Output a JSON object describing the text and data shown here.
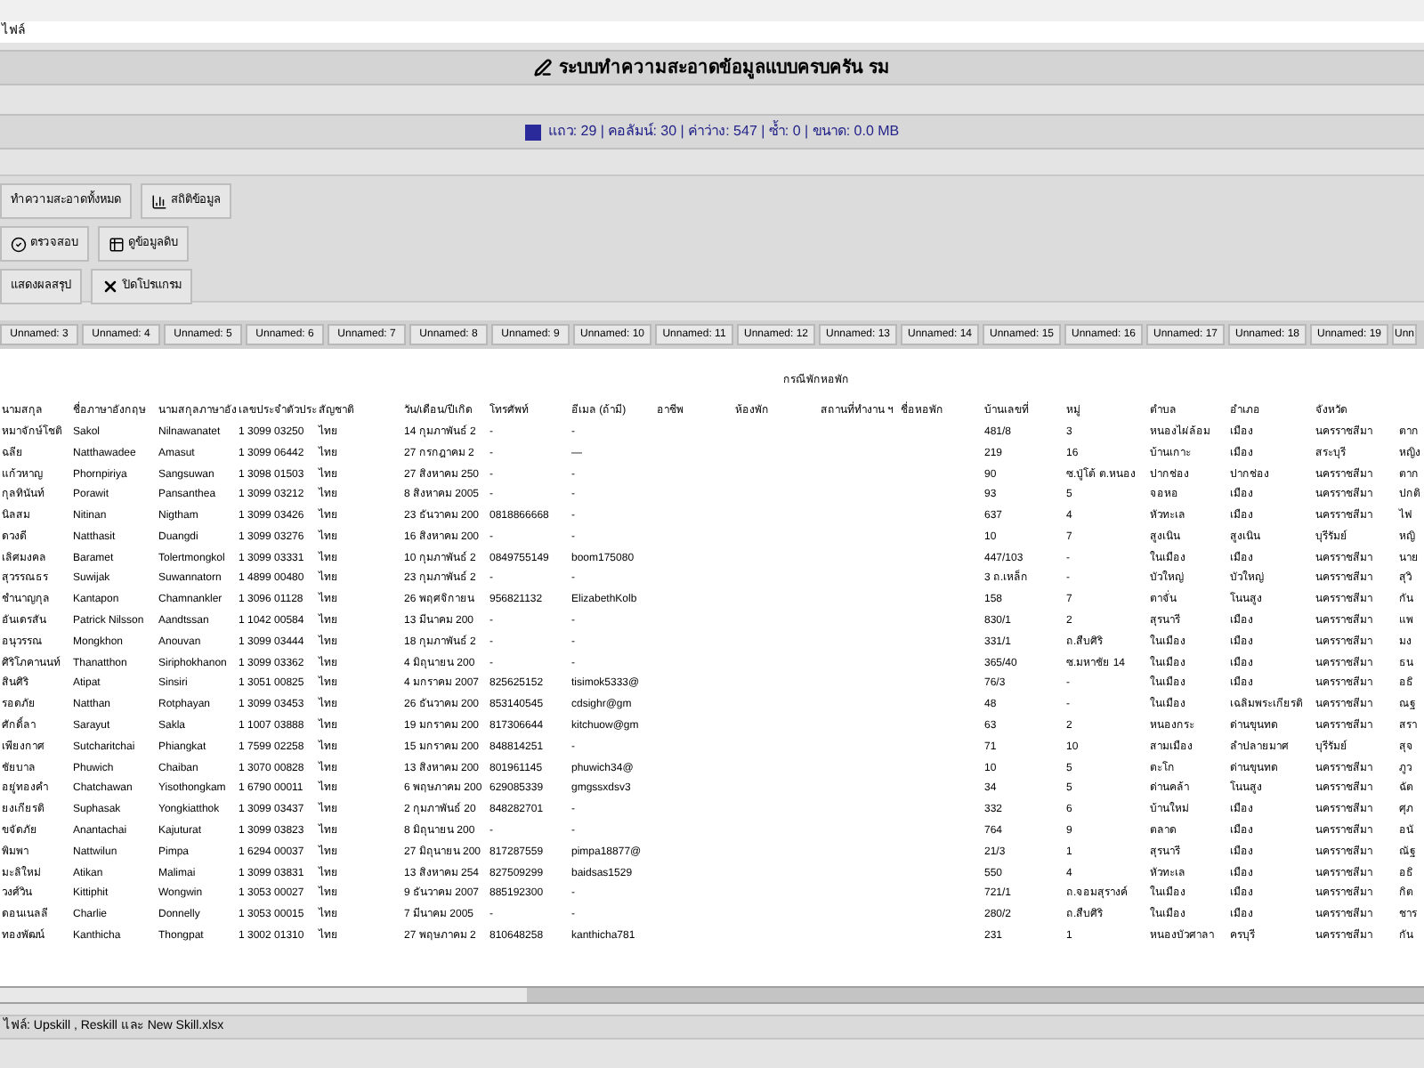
{
  "menu_bar": {
    "items": [
      "ไฟล์"
    ]
  },
  "title_bar": {
    "title": "ระบบทำความสะอาดข้อมูลแบบครบครัน รม"
  },
  "stats_bar": {
    "text": "แถว: 29 | คอลัมน์: 30 | ค่าว่าง: 547 | ซ้ำ: 0 | ขนาด: 0.0 MB"
  },
  "toolbar": {
    "rows": [
      [
        {
          "label": "ทำความสะอาดทั้งหมด",
          "kind": "plain"
        },
        {
          "label": "สถิติข้อมูล",
          "kind": "stats"
        }
      ],
      [
        {
          "label": "ตรวจสอบ",
          "kind": "check"
        },
        {
          "label": "ดูข้อมูลดิบ",
          "kind": "view"
        }
      ],
      [
        {
          "label": "แสดงผลสรุป",
          "kind": "plain"
        },
        {
          "label": "ปิดโปรแกรม",
          "kind": "exit"
        }
      ]
    ]
  },
  "column_chips": [
    "Unnamed: 3",
    "Unnamed: 4",
    "Unnamed: 5",
    "Unnamed: 6",
    "Unnamed: 7",
    "Unnamed: 8",
    "Unnamed: 9",
    "Unnamed: 10",
    "Unnamed: 11",
    "Unnamed: 12",
    "Unnamed: 13",
    "Unnamed: 14",
    "Unnamed: 15",
    "Unnamed: 16",
    "Unnamed: 17",
    "Unnamed: 18",
    "Unnamed: 19",
    "Unn"
  ],
  "table": {
    "group_header": "กรณีพักหอพัก",
    "columns": {
      "surname_th": "นามสกุล",
      "first_en": "ชื่อภาษาอังกฤษ",
      "last_en": "นามสกุลภาษาอัง",
      "id": "เลขประจำตัวประ",
      "nationality": "สัญชาติ",
      "dob": "วัน/เดือน/ปีเกิด",
      "phone": "โทรศัพท์",
      "email": "อีเมล (ถ้ามี)",
      "occupation": "อาชีพ",
      "dorm": "ห้องพัก",
      "workplace": "สถานที่ทำงาน ฯ",
      "dorm_name": "ชื่อหอพัก",
      "house_no": "บ้านเลขที่",
      "moo": "หมู่",
      "tambon": "ตำบล",
      "amphoe": "อำเภอ",
      "province": "จังหวัด"
    },
    "rows": [
      {
        "surname_th": "หมาจักษ์โชติ",
        "first_en": "Sakol",
        "last_en": "Nilnawanatet",
        "id": "1 3099 03250",
        "nationality": "ไทย",
        "dob": "14 กุมภาพันธ์ 2",
        "phone": "-",
        "email": "-",
        "house_no": "481/8",
        "moo": "3",
        "tambon": "หนองไผ่ล้อม",
        "amphoe": "เมือง",
        "province": "นครราชสีมา",
        "column_19": "ตาก"
      },
      {
        "surname_th": "ฉลีย",
        "first_en": "Natthawadee",
        "last_en": "Amasut",
        "id": "1 3099 06442",
        "nationality": "ไทย",
        "dob": "27 กรกฎาคม 2",
        "phone": "-",
        "email": "—",
        "house_no": "219",
        "moo": "16",
        "tambon": "บ้านเกาะ",
        "amphoe": "เมือง",
        "province": "สระบุรี",
        "column_19": "หญิง"
      },
      {
        "surname_th": "แก้วหาญ",
        "first_en": "Phornpiriya",
        "last_en": "Sangsuwan",
        "id": "1 3098 01503",
        "nationality": "ไทย",
        "dob": "27 สิงหาคม 250",
        "phone": "-",
        "email": "-",
        "house_no": "90",
        "moo": "ซ.ปู่โต้ ต.หนอง",
        "tambon": "ปากช่อง",
        "amphoe": "ปากช่อง",
        "province": "นครราชสีมา",
        "column_19": "ตาก"
      },
      {
        "surname_th": "กุลทินันท์",
        "first_en": "Porawit",
        "last_en": "Pansanthea",
        "id": "1 3099 03212",
        "nationality": "ไทย",
        "dob": "8 สิงหาคม 2005",
        "phone": "-",
        "email": "-",
        "house_no": "93",
        "moo": "5",
        "tambon": "จอหอ",
        "amphoe": "เมือง",
        "province": "นครราชสีมา",
        "column_19": "ปกติ"
      },
      {
        "surname_th": "นิลสม",
        "first_en": "Nitinan",
        "last_en": "Nigtham",
        "id": "1 3099 03426",
        "nationality": "ไทย",
        "dob": "23 ธันวาคม 200",
        "phone": "0818866668",
        "email": "-",
        "house_no": "637",
        "moo": "4",
        "tambon": "หัวทะเล",
        "amphoe": "เมือง",
        "province": "นครราชสีมา",
        "column_19": "ไฟ"
      },
      {
        "surname_th": "ดวงดี",
        "first_en": "Natthasit",
        "last_en": "Duangdi",
        "id": "1 3099 03276",
        "nationality": "ไทย",
        "dob": "16 สิงหาคม 200",
        "phone": "-",
        "email": "-",
        "house_no": "10",
        "moo": "7",
        "tambon": "สูงเนิน",
        "amphoe": "สูงเนิน",
        "province": "บุรีรัมย์",
        "column_19": "หญิ"
      },
      {
        "surname_th": "เลิศมงคล",
        "first_en": "Baramet",
        "last_en": "Tolertmongkol",
        "id": "1 3099 03331",
        "nationality": "ไทย",
        "dob": "10 กุมภาพันธ์ 2",
        "phone": "0849755149",
        "email": "boom175080",
        "house_no": "447/103",
        "moo": "-",
        "tambon": "ในเมือง",
        "amphoe": "เมือง",
        "province": "นครราชสีมา",
        "column_19": "นาย"
      },
      {
        "surname_th": "สุวรรณธร",
        "first_en": "Suwijak",
        "last_en": "Suwannatorn",
        "id": "1 4899 00480",
        "nationality": "ไทย",
        "dob": "23 กุมภาพันธ์ 2",
        "phone": "-",
        "email": "-",
        "house_no": "3 ถ.เหล็ก",
        "moo": "-",
        "tambon": "บัวใหญ่",
        "amphoe": "บัวใหญ่",
        "province": "นครราชสีมา",
        "column_19": "สุวิ"
      },
      {
        "surname_th": "ชำนาญกุล",
        "first_en": "Kantapon",
        "last_en": "Chamnankler",
        "id": "1 3096 01128",
        "nationality": "ไทย",
        "dob": "26 พฤศจิกายน",
        "phone": "956821132",
        "email": "ElizabethKolb",
        "house_no": "158",
        "moo": "7",
        "tambon": "ตาจั่น",
        "amphoe": "โนนสูง",
        "province": "นครราชสีมา",
        "column_19": "กัน"
      },
      {
        "surname_th": "อันเดรสัน",
        "first_en": "Patrick Nilsson",
        "last_en": "Aandtssan",
        "id": "1 1042 00584",
        "nationality": "ไทย",
        "dob": "13 มีนาคม 200",
        "phone": "-",
        "email": "-",
        "house_no": "830/1",
        "moo": "2",
        "tambon": "สุรนารี",
        "amphoe": "เมือง",
        "province": "นครราชสีมา",
        "column_19": "แพ"
      },
      {
        "surname_th": "อนุวรรณ",
        "first_en": "Mongkhon",
        "last_en": "Anouvan",
        "id": "1 3099 03444",
        "nationality": "ไทย",
        "dob": "18 กุมภาพันธ์ 2",
        "phone": "-",
        "email": "-",
        "house_no": "331/1",
        "moo": "ถ.สืบศิริ",
        "tambon": "ในเมือง",
        "amphoe": "เมือง",
        "province": "นครราชสีมา",
        "column_19": "มง"
      },
      {
        "surname_th": "ศิริโภคานนท์",
        "first_en": "Thanatthon",
        "last_en": "Siriphokhanon",
        "id": "1 3099 03362",
        "nationality": "ไทย",
        "dob": "4 มิถุนายน 200",
        "phone": "-",
        "email": "-",
        "house_no": "365/40",
        "moo": "ซ.มหาชัย 14",
        "tambon": "ในเมือง",
        "amphoe": "เมือง",
        "province": "นครราชสีมา",
        "column_19": "ธน"
      },
      {
        "surname_th": "สินศิริ",
        "first_en": "Atipat",
        "last_en": "Sinsiri",
        "id": "1 3051 00825",
        "nationality": "ไทย",
        "dob": "4 มกราคม 2007",
        "phone": "825625152",
        "email": "tisimok5333@",
        "house_no": "76/3",
        "moo": "-",
        "tambon": "ในเมือง",
        "amphoe": "เมือง",
        "province": "นครราชสีมา",
        "column_19": "อธิ"
      },
      {
        "surname_th": "รอดภัย",
        "first_en": "Natthan",
        "last_en": "Rotphayan",
        "id": "1 3099 03453",
        "nationality": "ไทย",
        "dob": "26 ธันวาคม 200",
        "phone": "853140545",
        "email": "cdsighr@gm",
        "house_no": "48",
        "moo": "-",
        "tambon": "ในเมือง",
        "amphoe": "เฉลิมพระเกียรติ",
        "province": "นครราชสีมา",
        "column_19": "ณฐ"
      },
      {
        "surname_th": "ศักดิ์ลา",
        "first_en": "Sarayut",
        "last_en": "Sakla",
        "id": "1 1007 03888",
        "nationality": "ไทย",
        "dob": "19 มกราคม 200",
        "phone": "817306644",
        "email": "kitchuow@gm",
        "house_no": "63",
        "moo": "2",
        "tambon": "หนองกระ",
        "amphoe": "ด่านขุนทด",
        "province": "นครราชสีมา",
        "column_19": "สรา"
      },
      {
        "surname_th": "เพียงกาศ",
        "first_en": "Sutcharitchai",
        "last_en": "Phiangkat",
        "id": "1 7599 02258",
        "nationality": "ไทย",
        "dob": "15 มกราคม 200",
        "phone": "848814251",
        "email": "-",
        "house_no": "71",
        "moo": "10",
        "tambon": "สามเมือง",
        "amphoe": "ลำปลายมาศ",
        "province": "บุรีรัมย์",
        "column_19": "สุจ"
      },
      {
        "surname_th": "ชัยบาล",
        "first_en": "Phuwich",
        "last_en": "Chaiban",
        "id": "1 3070 00828",
        "nationality": "ไทย",
        "dob": "13 สิงหาคม 200",
        "phone": "801961145",
        "email": "phuwich34@",
        "house_no": "10",
        "moo": "5",
        "tambon": "ตะโก",
        "amphoe": "ด่านขุนทด",
        "province": "นครราชสีมา",
        "column_19": "ภูว"
      },
      {
        "surname_th": "อยู่ทองคำ",
        "first_en": "Chatchawan",
        "last_en": "Yisothongkam",
        "id": "1 6790 00011",
        "nationality": "ไทย",
        "dob": "6 พฤษภาคม 200",
        "phone": "629085339",
        "email": "gmgssxdsv3",
        "house_no": "34",
        "moo": "5",
        "tambon": "ด่านคล้า",
        "amphoe": "โนนสูง",
        "province": "นครราชสีมา",
        "column_19": "ฉัต"
      },
      {
        "surname_th": "ยงเกียรติ",
        "first_en": "Suphasak",
        "last_en": "Yongkiatthok",
        "id": "1 3099 03437",
        "nationality": "ไทย",
        "dob": "2 กุมภาพันธ์ 20",
        "phone": "848282701",
        "email": "-",
        "house_no": "332",
        "moo": "6",
        "tambon": "บ้านใหม่",
        "amphoe": "เมือง",
        "province": "นครราชสีมา",
        "column_19": "ศุภ"
      },
      {
        "surname_th": "ขจัดภัย",
        "first_en": "Anantachai",
        "last_en": "Kajuturat",
        "id": "1 3099 03823",
        "nationality": "ไทย",
        "dob": "8 มิถุนายน 200",
        "phone": "-",
        "email": "-",
        "house_no": "764",
        "moo": "9",
        "tambon": "ตลาด",
        "amphoe": "เมือง",
        "province": "นครราชสีมา",
        "column_19": "อนั"
      },
      {
        "surname_th": "พิมพา",
        "first_en": "Nattwilun",
        "last_en": "Pimpa",
        "id": "1 6294 00037",
        "nationality": "ไทย",
        "dob": "27 มิถุนายน 200",
        "phone": "817287559",
        "email": "pimpa18877@",
        "house_no": "21/3",
        "moo": "1",
        "tambon": "สุรนารี",
        "amphoe": "เมือง",
        "province": "นครราชสีมา",
        "column_19": "ณัฐ"
      },
      {
        "surname_th": "มะลิใหม่",
        "first_en": "Atikan",
        "last_en": "Malimai",
        "id": "1 3099 03831",
        "nationality": "ไทย",
        "dob": "13 สิงหาคม 254",
        "phone": "827509299",
        "email": "baidsas1529",
        "house_no": "550",
        "moo": "4",
        "tambon": "หัวทะเล",
        "amphoe": "เมือง",
        "province": "นครราชสีมา",
        "column_19": "อธิ"
      },
      {
        "surname_th": "วงศ์วิน",
        "first_en": "Kittiphit",
        "last_en": "Wongwin",
        "id": "1 3053 00027",
        "nationality": "ไทย",
        "dob": "9 ธันวาคม 2007",
        "phone": "885192300",
        "email": "-",
        "house_no": "721/1",
        "moo": "ถ.จอมสุรางค์",
        "tambon": "ในเมือง",
        "amphoe": "เมือง",
        "province": "นครราชสีมา",
        "column_19": "กิต"
      },
      {
        "surname_th": "ดอนเนลลี",
        "first_en": "Charlie",
        "last_en": "Donnelly",
        "id": "1 3053 00015",
        "nationality": "ไทย",
        "dob": "7 มีนาคม 2005",
        "phone": "-",
        "email": "-",
        "house_no": "280/2",
        "moo": "ถ.สืบศิริ",
        "tambon": "ในเมือง",
        "amphoe": "เมือง",
        "province": "นครราชสีมา",
        "column_19": "ชาร"
      },
      {
        "surname_th": "ทองพัฒน์",
        "first_en": "Kanthicha",
        "last_en": "Thongpat",
        "id": "1 3002 01310",
        "nationality": "ไทย",
        "dob": "27 พฤษภาคม 2",
        "phone": "810648258",
        "email": "kanthicha781",
        "house_no": "231",
        "moo": "1",
        "tambon": "หนองบัวศาลา",
        "amphoe": "ครบุรี",
        "province": "นครราชสีมา",
        "column_19": "กัน"
      }
    ]
  },
  "status_bar": {
    "text": "ไฟล์: Upskill , Reskill และ New Skill.xlsx"
  }
}
